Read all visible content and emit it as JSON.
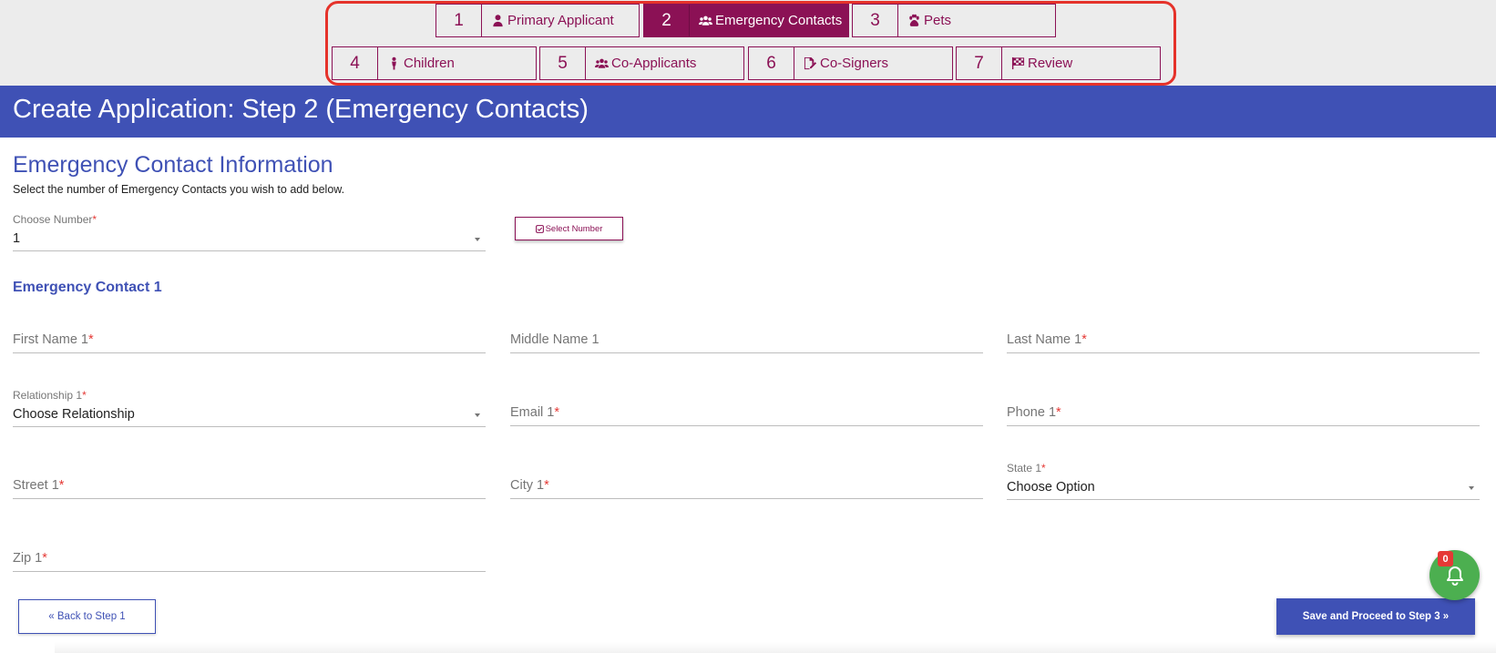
{
  "stepper": {
    "steps": [
      {
        "number": "1",
        "label": "Primary Applicant",
        "icon": "user-icon"
      },
      {
        "number": "2",
        "label": "Emergency Contacts",
        "icon": "users-icon",
        "active": true
      },
      {
        "number": "3",
        "label": "Pets",
        "icon": "paw-icon"
      },
      {
        "number": "4",
        "label": "Children",
        "icon": "child-icon"
      },
      {
        "number": "5",
        "label": "Co-Applicants",
        "icon": "users-icon"
      },
      {
        "number": "6",
        "label": "Co-Signers",
        "icon": "signature-icon"
      },
      {
        "number": "7",
        "label": "Review",
        "icon": "flag-checkered-icon"
      }
    ]
  },
  "header": {
    "title": "Create Application: Step 2 (Emergency Contacts)"
  },
  "form": {
    "heading": "Emergency Contact Information",
    "instructions": "Select the number of Emergency Contacts you wish to add below.",
    "choose_number": {
      "label": "Choose Number",
      "required": "*",
      "value": "1"
    },
    "select_number_button": "Select Number",
    "contact_heading": "Emergency Contact 1",
    "fields": {
      "first_name": {
        "label": "First Name 1",
        "required": "*"
      },
      "middle_name": {
        "label": "Middle Name 1"
      },
      "last_name": {
        "label": "Last Name 1",
        "required": "*"
      },
      "relationship": {
        "label": "Relationship 1",
        "required": "*",
        "value": "Choose Relationship"
      },
      "email": {
        "label": "Email 1",
        "required": "*"
      },
      "phone": {
        "label": "Phone 1",
        "required": "*"
      },
      "street": {
        "label": "Street 1",
        "required": "*"
      },
      "city": {
        "label": "City 1",
        "required": "*"
      },
      "state": {
        "label": "State 1",
        "required": "*",
        "value": "Choose Option"
      },
      "zip": {
        "label": "Zip 1",
        "required": "*"
      }
    }
  },
  "actions": {
    "back_label": "« Back to Step 1",
    "save_label": "Save and Proceed to Step 3 »"
  },
  "notifications": {
    "count": "0",
    "icon": "bell-icon"
  },
  "colors": {
    "primary": "#3f51b5",
    "accent": "#8b1155",
    "highlight": "#e5322a",
    "success": "#4caf50",
    "required": "#e53935"
  }
}
